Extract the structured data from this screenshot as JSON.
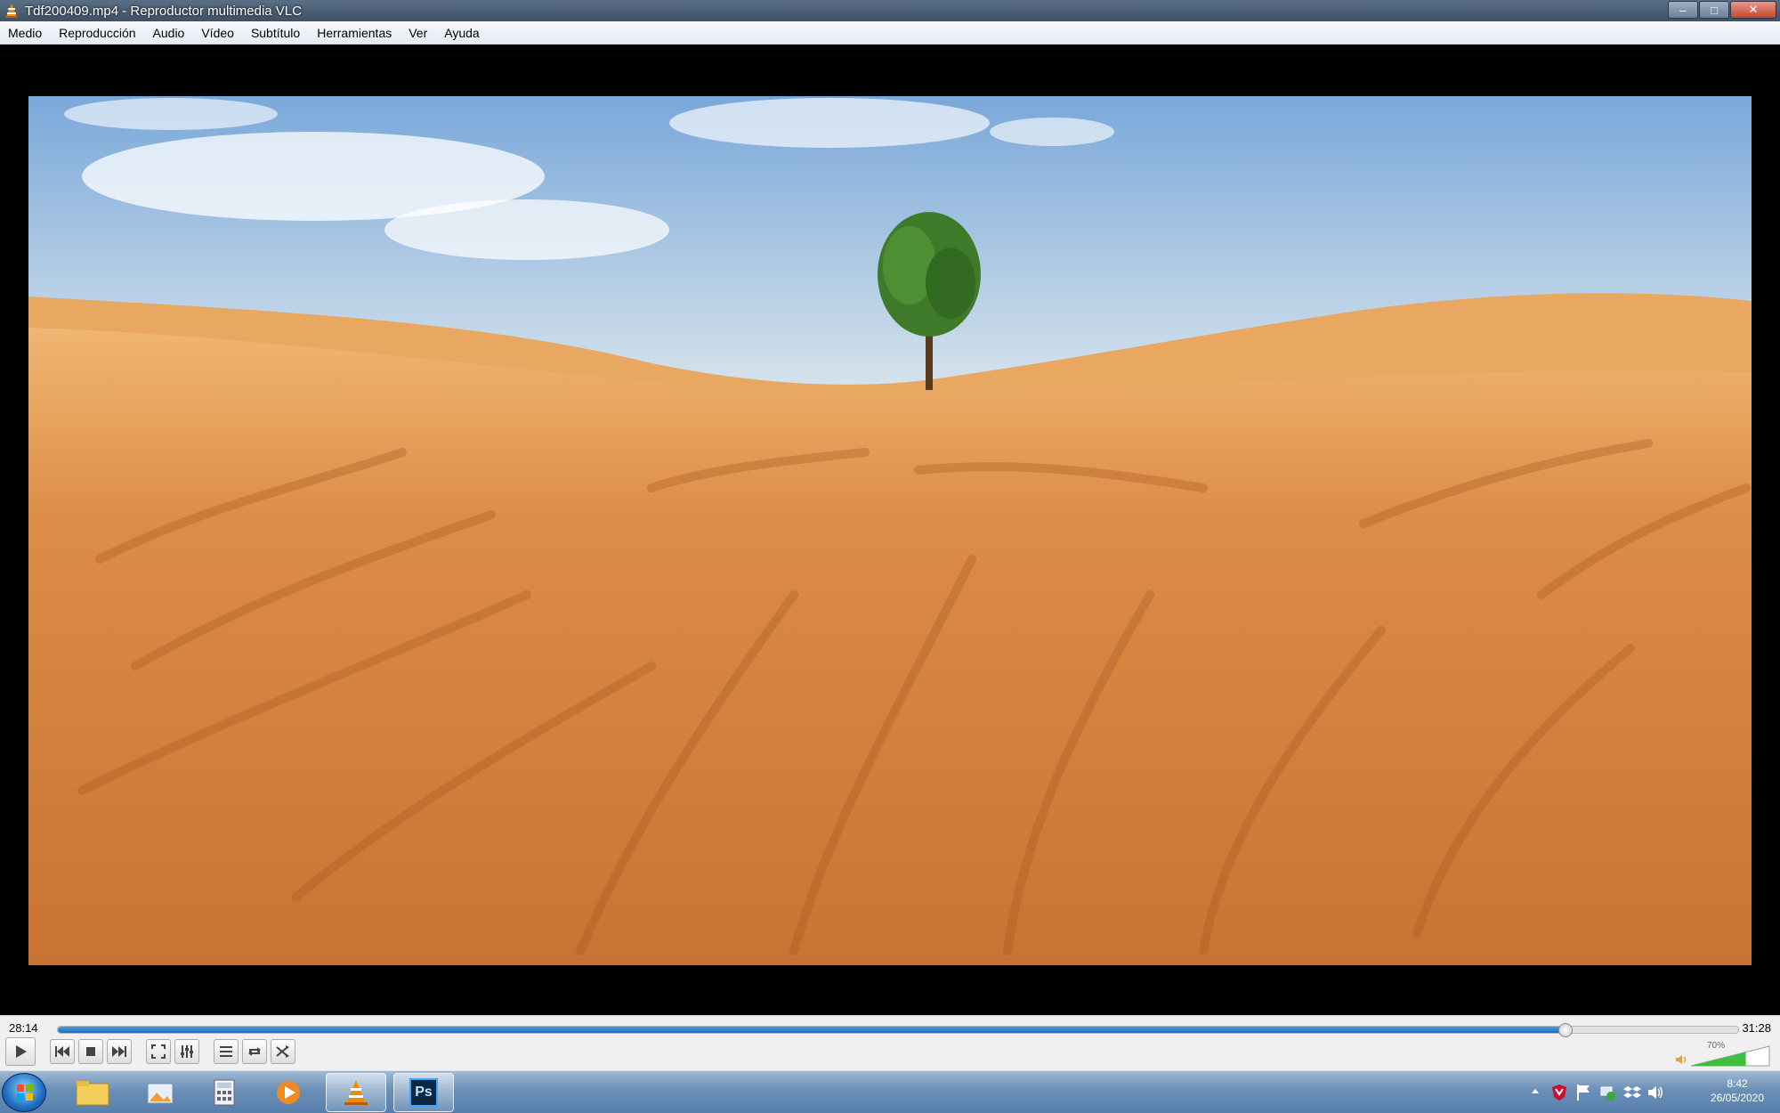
{
  "window": {
    "title": "Tdf200409.mp4 - Reproductor multimedia VLC",
    "minimize_label": "–",
    "maximize_label": "□",
    "close_label": "✕"
  },
  "menu": {
    "items": [
      "Medio",
      "Reproducción",
      "Audio",
      "Vídeo",
      "Subtítulo",
      "Herramientas",
      "Ver",
      "Ayuda"
    ]
  },
  "playback": {
    "elapsed": "28:14",
    "total": "31:28",
    "progress_fraction": 0.897
  },
  "controls": {
    "play_icon": "play-icon",
    "prev_icon": "previous-icon",
    "stop_icon": "stop-icon",
    "next_icon": "next-icon",
    "fullscreen_icon": "fullscreen-icon",
    "extended_icon": "equalizer-icon",
    "playlist_icon": "playlist-icon",
    "loop_icon": "loop-icon",
    "shuffle_icon": "shuffle-icon"
  },
  "volume": {
    "label": "70%",
    "level_fraction": 0.7
  },
  "taskbar": {
    "time": "8:42",
    "date": "26/05/2020",
    "photoshop_label": "Ps"
  },
  "colors": {
    "seek_fill": "#1f6fc4",
    "volume_fill": "#3fbf3f",
    "vlc_orange": "#f08a00"
  }
}
